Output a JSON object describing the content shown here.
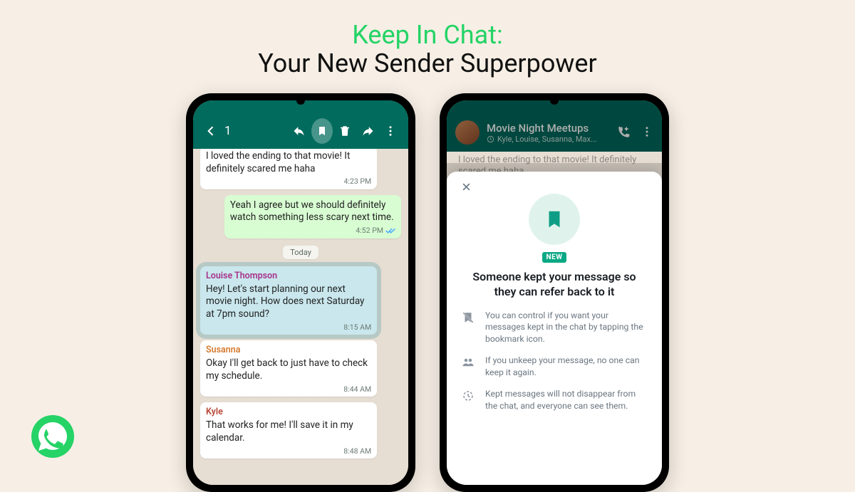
{
  "headline": {
    "line1": "Keep In Chat:",
    "line2": "Your New Sender Superpower"
  },
  "phone1": {
    "selection_count": "1",
    "messages": {
      "m0": {
        "text": "I loved the ending to that movie! It definitely scared me haha",
        "time": "4:23 PM"
      },
      "m1": {
        "text": "Yeah I agree but we should definitely watch something less scary next time.",
        "time": "4:52 PM"
      },
      "date": "Today",
      "m2": {
        "sender": "Louise Thompson",
        "text": "Hey! Let's start planning our next movie night. How does next Saturday at 7pm sound?",
        "time": "8:15 AM"
      },
      "m3": {
        "sender": "Susanna",
        "text": "Okay I'll get back to just have to check my schedule.",
        "time": "8:44 AM"
      },
      "m4": {
        "sender": "Kyle",
        "text": "That works for me! I'll save it in my calendar.",
        "time": "8:48 AM"
      }
    },
    "sender_colors": {
      "louise": "#a8328a",
      "susanna": "#d57a2e",
      "kyle": "#b74636"
    }
  },
  "phone2": {
    "header": {
      "title": "Movie Night Meetups",
      "subtitle": "Kyle, Louise, Susanna, Max..."
    },
    "peek": "I loved the ending to that movie! It definitely scared me haha",
    "sheet": {
      "badge": "NEW",
      "title": "Someone kept your message so they can refer back to it",
      "rows": {
        "r1": "You can control if you want your messages kept in the chat by tapping the bookmark icon.",
        "r2": "If you unkeep your message, no one can keep it again.",
        "r3": "Kept messages will not disappear from the chat, and everyone can see them."
      }
    }
  }
}
